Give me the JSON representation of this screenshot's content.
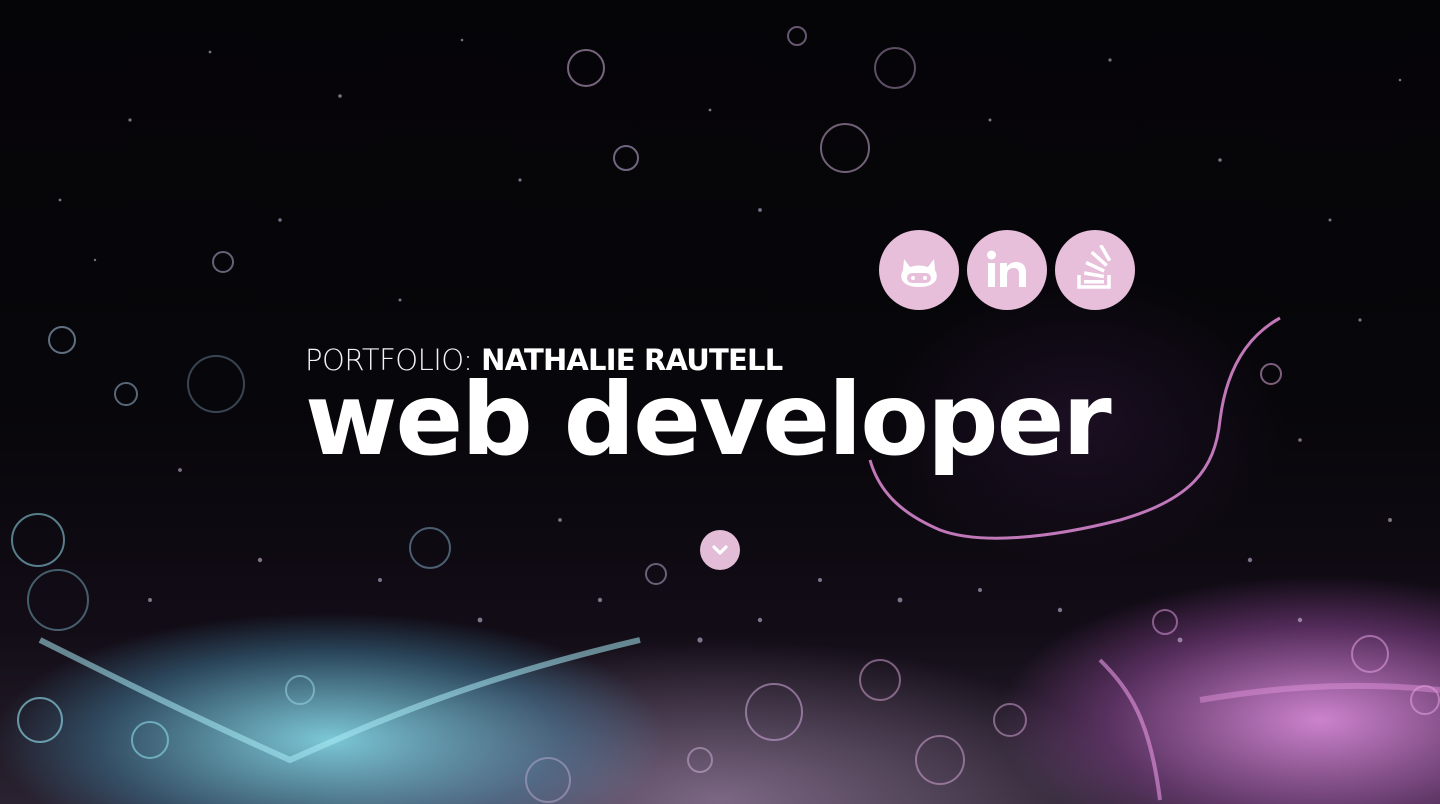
{
  "hero": {
    "kicker_prefix": "PORTFOLIO:",
    "kicker_name": "NATHALIE RAUTELL",
    "headline": "web developer"
  },
  "social": {
    "items": [
      {
        "name": "github",
        "icon": "github-icon"
      },
      {
        "name": "linkedin",
        "icon": "linkedin-icon",
        "label": "in"
      },
      {
        "name": "stackoverflow",
        "icon": "stackoverflow-icon"
      }
    ]
  },
  "scroll": {
    "icon": "chevron-down-icon"
  },
  "colors": {
    "accent": "#e7bfdb",
    "text": "#ffffff",
    "background": "#050407"
  }
}
